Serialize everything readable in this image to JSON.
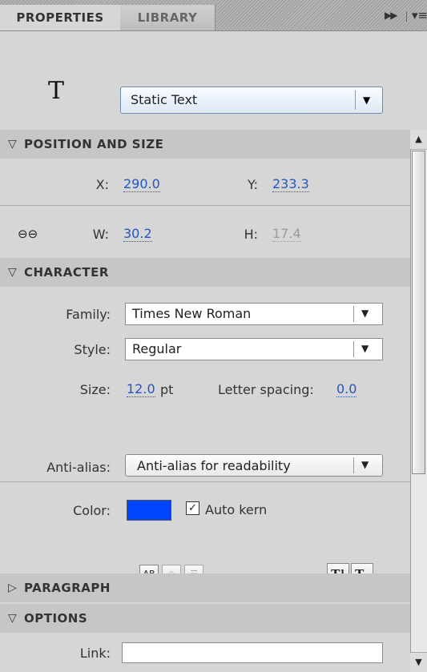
{
  "tabs": {
    "properties": "PROPERTIES",
    "library": "LIBRARY"
  },
  "header": {
    "text_type_value": "Static Text",
    "text_tool_glyph": "T"
  },
  "sections": {
    "position_size": "POSITION AND SIZE",
    "character": "CHARACTER",
    "paragraph": "PARAGRAPH",
    "options": "OPTIONS"
  },
  "position": {
    "x_label": "X:",
    "x_value": "290.0",
    "y_label": "Y:",
    "y_value": "233.3",
    "w_label": "W:",
    "w_value": "30.2",
    "h_label": "H:",
    "h_value": "17.4"
  },
  "character": {
    "family_label": "Family:",
    "family_value": "Times New Roman",
    "style_label": "Style:",
    "style_value": "Regular",
    "size_label": "Size:",
    "size_value": "12.0",
    "size_unit": "pt",
    "letter_spacing_label": "Letter spacing:",
    "letter_spacing_value": "0.0",
    "color_label": "Color:",
    "color_value": "#0044ff",
    "auto_kern_label": "Auto kern",
    "auto_kern_checked": true,
    "anti_alias_label": "Anti-alias:",
    "anti_alias_value": "Anti-alias for readability",
    "format_buttons": [
      "selectable",
      "render-html",
      "show-border",
      "superscript",
      "subscript"
    ]
  },
  "options": {
    "link_label": "Link:",
    "link_value": ""
  },
  "icons": [
    "link-chain-icon",
    "collapse-panel-icon",
    "panel-menu-icon",
    "text-tool-icon",
    "triangle-down-icon",
    "triangle-right-icon"
  ]
}
